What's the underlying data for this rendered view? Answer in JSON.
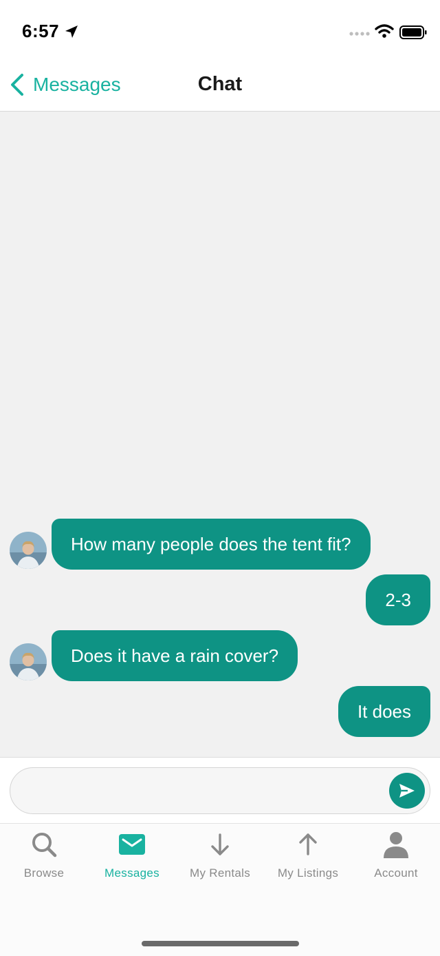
{
  "status_bar": {
    "time": "6:57",
    "icons": [
      "location-arrow-icon",
      "signal-icon",
      "wifi-icon",
      "battery-icon"
    ]
  },
  "nav": {
    "back_label": "Messages",
    "title": "Chat"
  },
  "messages": [
    {
      "direction": "incoming",
      "text": "How many people does the tent fit?"
    },
    {
      "direction": "outgoing",
      "text": "2-3"
    },
    {
      "direction": "incoming",
      "text": "Does it have a rain cover?"
    },
    {
      "direction": "outgoing",
      "text": "It does"
    }
  ],
  "composer": {
    "value": "",
    "send_icon": "send-icon"
  },
  "tabs": [
    {
      "label": "Browse",
      "icon": "search-icon",
      "active": false
    },
    {
      "label": "Messages",
      "icon": "envelope-icon",
      "active": true
    },
    {
      "label": "My Rentals",
      "icon": "arrow-down-icon",
      "active": false
    },
    {
      "label": "My Listings",
      "icon": "arrow-up-icon",
      "active": false
    },
    {
      "label": "Account",
      "icon": "person-icon",
      "active": false
    }
  ],
  "colors": {
    "accent": "#19b2a0",
    "bubble": "#0e9384",
    "chat_background": "#f1f1f1",
    "tab_inactive": "#8a8a8a"
  }
}
